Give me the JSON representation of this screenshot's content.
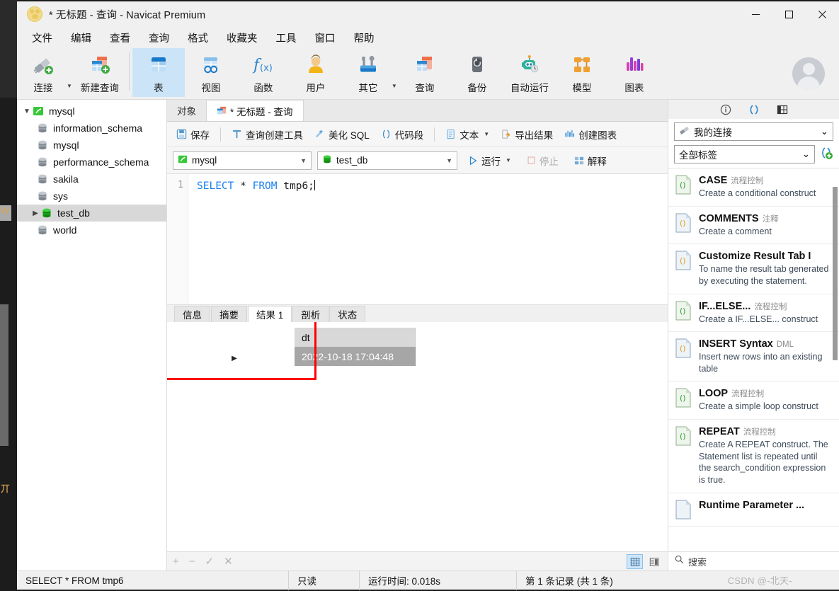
{
  "window": {
    "title": "* 无标题 - 查询 - Navicat Premium",
    "logo_icon": "navicat-paw-logo",
    "minimize_label": "最小化",
    "maximize_label": "最大化",
    "close_label": "关闭"
  },
  "menubar": {
    "items": [
      {
        "label": "文件"
      },
      {
        "label": "编辑"
      },
      {
        "label": "查看"
      },
      {
        "label": "查询"
      },
      {
        "label": "格式"
      },
      {
        "label": "收藏夹"
      },
      {
        "label": "工具"
      },
      {
        "label": "窗口"
      },
      {
        "label": "帮助"
      }
    ]
  },
  "toolbar": {
    "items": [
      {
        "label": "连接",
        "icon": "connection-plug-icon",
        "selected": false
      },
      {
        "label": "新建查询",
        "icon": "new-query-icon",
        "selected": false
      },
      {
        "label": "表",
        "icon": "table-icon",
        "selected": true
      },
      {
        "label": "视图",
        "icon": "view-icon",
        "selected": false
      },
      {
        "label": "函数",
        "icon": "function-fx-icon",
        "selected": false
      },
      {
        "label": "用户",
        "icon": "user-icon",
        "selected": false
      },
      {
        "label": "其它",
        "icon": "others-tools-icon",
        "selected": false
      },
      {
        "label": "查询",
        "icon": "query-icon",
        "selected": false
      },
      {
        "label": "备份",
        "icon": "backup-icon",
        "selected": false
      },
      {
        "label": "自动运行",
        "icon": "automation-robot-icon",
        "selected": false
      },
      {
        "label": "模型",
        "icon": "model-icon",
        "selected": false
      },
      {
        "label": "图表",
        "icon": "chart-icon",
        "selected": false
      }
    ],
    "avatar_icon": "user-avatar"
  },
  "tree": {
    "root": {
      "label": "mysql",
      "icon": "mysql-connection-icon",
      "expanded": true
    },
    "items": [
      {
        "label": "information_schema",
        "icon": "database-icon",
        "selected": false,
        "expandable": false
      },
      {
        "label": "mysql",
        "icon": "database-icon",
        "selected": false,
        "expandable": false
      },
      {
        "label": "performance_schema",
        "icon": "database-icon",
        "selected": false,
        "expandable": false
      },
      {
        "label": "sakila",
        "icon": "database-icon",
        "selected": false,
        "expandable": false
      },
      {
        "label": "sys",
        "icon": "database-icon",
        "selected": false,
        "expandable": false
      },
      {
        "label": "test_db",
        "icon": "database-open-icon",
        "selected": true,
        "expandable": true
      },
      {
        "label": "world",
        "icon": "database-icon",
        "selected": false,
        "expandable": false
      }
    ]
  },
  "tabs": [
    {
      "label": "对象",
      "active": false,
      "icon": ""
    },
    {
      "label": "* 无标题 - 查询",
      "active": true,
      "icon": "query-tab-icon"
    }
  ],
  "query_toolbar": {
    "save": "保存",
    "query_builder": "查询创建工具",
    "beautify_sql": "美化 SQL",
    "code_snippet": "代码段",
    "text": "文本",
    "export_result": "导出结果",
    "create_chart": "创建图表"
  },
  "query_bar": {
    "connection": "mysql",
    "connection_icon": "mysql-connection-icon",
    "database": "test_db",
    "database_icon": "database-open-icon",
    "run": "运行",
    "stop": "停止",
    "explain": "解释"
  },
  "editor": {
    "line_number": "1",
    "sql_keyword_1": "SELECT",
    "sql_star": "*",
    "sql_keyword_2": "FROM",
    "sql_table": "tmp6;",
    "full_sql": "SELECT * FROM tmp6;"
  },
  "result_tabs": [
    {
      "label": "信息",
      "active": false
    },
    {
      "label": "摘要",
      "active": false
    },
    {
      "label": "结果 1",
      "active": true
    },
    {
      "label": "剖析",
      "active": false
    },
    {
      "label": "状态",
      "active": false
    }
  ],
  "result_grid": {
    "columns": [
      "dt"
    ],
    "rows": [
      [
        "2022-10-18 17:04:48"
      ]
    ],
    "row_marker": "▶",
    "highlight_color": "#ff0000"
  },
  "result_footer": {
    "add": "+",
    "remove": "−",
    "confirm": "✓",
    "cancel": "✕",
    "grid_view_icon": "grid-view-icon",
    "form_view_icon": "form-view-icon"
  },
  "right_panel": {
    "tab_icons": [
      {
        "icon": "info-icon",
        "label": "信息"
      },
      {
        "icon": "code-snippet-icon",
        "label": "代码段"
      },
      {
        "icon": "structure-icon",
        "label": "结构"
      }
    ],
    "connection_select": {
      "value": "我的连接",
      "icon": "connection-plug-icon"
    },
    "tag_select": {
      "value": "全部标签"
    },
    "add_snippet_icon": "add-snippet-icon",
    "snippets": [
      {
        "title": "CASE",
        "category": "流程控制",
        "desc": "Create a conditional construct",
        "cat_color": "#7fbf7f"
      },
      {
        "title": "COMMENTS",
        "category": "注释",
        "desc": "Create a comment",
        "cat_color": "#d9a441"
      },
      {
        "title": "Customize Result Tab I",
        "category": "",
        "desc": "To name the result tab generated by executing the statement.",
        "cat_color": "#d9a441"
      },
      {
        "title": "IF...ELSE...",
        "category": "流程控制",
        "desc": "Create a IF...ELSE... construct",
        "cat_color": "#7fbf7f"
      },
      {
        "title": "INSERT Syntax",
        "category": "DML",
        "desc": "Insert new rows into an existing table",
        "cat_color": "#d9a441"
      },
      {
        "title": "LOOP",
        "category": "流程控制",
        "desc": "Create a simple loop construct",
        "cat_color": "#7fbf7f"
      },
      {
        "title": "REPEAT",
        "category": "流程控制",
        "desc": "Create A REPEAT construct. The Statement list is repeated until the search_condition expression is true.",
        "cat_color": "#7fbf7f"
      },
      {
        "title": "Runtime Parameter ...",
        "category": "",
        "desc": "",
        "cat_color": "#d9a441"
      }
    ],
    "search_placeholder": "搜索",
    "search_icon": "search-icon"
  },
  "statusbar": {
    "sql": "SELECT * FROM tmp6",
    "mode": "只读",
    "runtime": "运行时间: 0.018s",
    "records": "第 1 条记录 (共 1 条)"
  },
  "watermark": "CSDN @-北天-"
}
